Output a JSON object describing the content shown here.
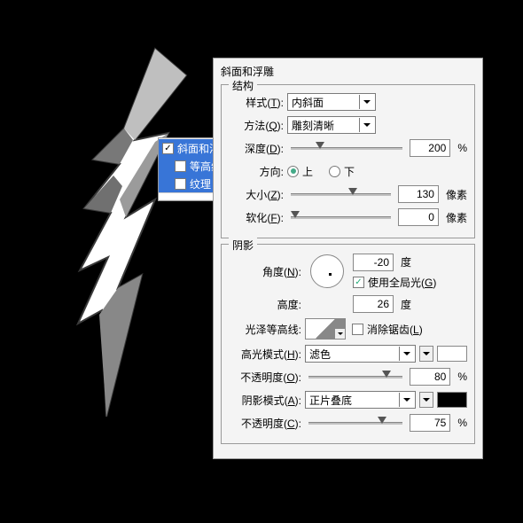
{
  "dialog": {
    "title": "斜面和浮雕"
  },
  "fx": {
    "bevel": "斜面和浮雕",
    "contour": "等高线",
    "texture": "纹理"
  },
  "structure": {
    "title": "结构",
    "style_label": "样式",
    "style_key": "T",
    "style_value": "内斜面",
    "technique_label": "方法",
    "technique_key": "Q",
    "technique_value": "雕刻清晰",
    "depth_label": "深度",
    "depth_key": "D",
    "depth_value": "200",
    "depth_unit": "%",
    "direction_label": "方向:",
    "direction_up": "上",
    "direction_down": "下",
    "size_label": "大小",
    "size_key": "Z",
    "size_value": "130",
    "size_unit": "像素",
    "soften_label": "软化",
    "soften_key": "F",
    "soften_value": "0",
    "soften_unit": "像素"
  },
  "shading": {
    "title": "阴影",
    "angle_label": "角度",
    "angle_key": "N",
    "angle_value": "-20",
    "angle_unit": "度",
    "global_light": "使用全局光",
    "global_key": "G",
    "altitude_label": "高度:",
    "altitude_value": "26",
    "altitude_unit": "度",
    "gloss_label": "光泽等高线:",
    "antialias": "消除锯齿",
    "antialias_key": "L",
    "highlight_mode_label": "高光模式",
    "highlight_mode_key": "H",
    "highlight_mode_value": "滤色",
    "highlight_op_label": "不透明度",
    "highlight_op_key": "O",
    "highlight_op_value": "80",
    "highlight_op_unit": "%",
    "shadow_mode_label": "阴影模式",
    "shadow_mode_key": "A",
    "shadow_mode_value": "正片叠底",
    "shadow_op_label": "不透明度",
    "shadow_op_key": "C",
    "shadow_op_value": "75",
    "shadow_op_unit": "%"
  }
}
